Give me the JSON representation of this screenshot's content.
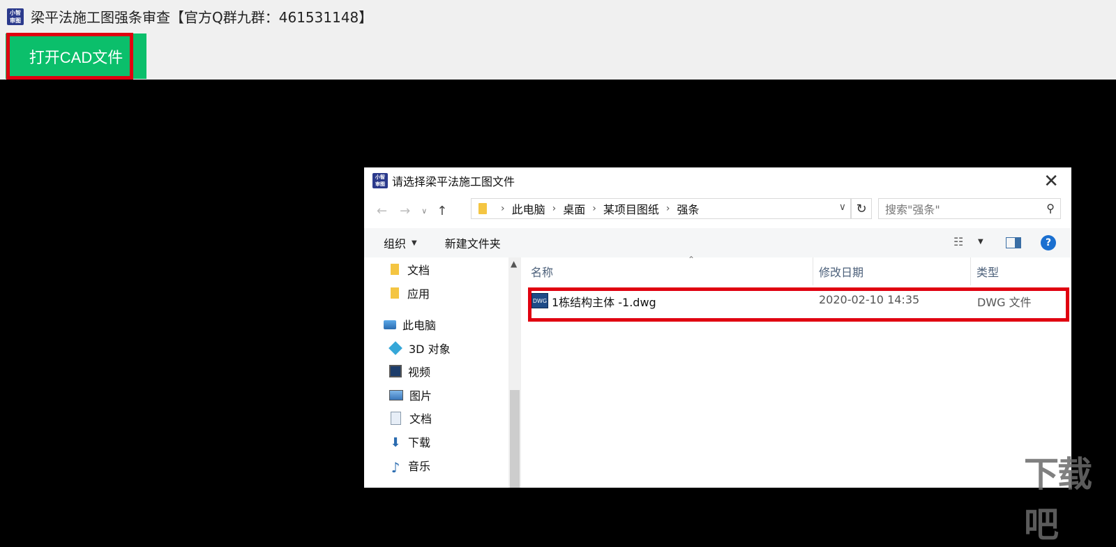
{
  "app": {
    "title": "梁平法施工图强条审查【官方Q群九群：461531148】",
    "logo_top": "小智",
    "logo_bottom": "审图"
  },
  "toolbar": {
    "open_cad_label": "打开CAD文件"
  },
  "dialog": {
    "title": "请选择梁平法施工图文件",
    "close_glyph": "✕",
    "nav": {
      "back": "←",
      "forward": "→",
      "dropdown": "∨",
      "up": "↑",
      "refresh": "↻"
    },
    "breadcrumb": [
      "此电脑",
      "桌面",
      "某项目图纸",
      "强条"
    ],
    "search_placeholder": "搜索\"强条\"",
    "commands": {
      "organize": "组织",
      "new_folder": "新建文件夹"
    },
    "nav_pane": [
      {
        "label": "文档",
        "icon": "folder-icon"
      },
      {
        "label": "应用",
        "icon": "folder-icon"
      },
      {
        "label": "此电脑",
        "icon": "computer-icon"
      },
      {
        "label": "3D 对象",
        "icon": "3d-objects-icon"
      },
      {
        "label": "视频",
        "icon": "video-icon"
      },
      {
        "label": "图片",
        "icon": "picture-icon"
      },
      {
        "label": "文档",
        "icon": "document-icon"
      },
      {
        "label": "下载",
        "icon": "download-icon"
      },
      {
        "label": "音乐",
        "icon": "music-icon"
      }
    ],
    "columns": {
      "name": "名称",
      "date": "修改日期",
      "type": "类型"
    },
    "files": [
      {
        "name": "1栋结构主体 -1.dwg",
        "date": "2020-02-10 14:35",
        "type": "DWG 文件",
        "icon": "dwg-file-icon"
      }
    ]
  },
  "watermark": {
    "text": "下载吧"
  },
  "colors": {
    "accent_green": "#0bbf6b",
    "highlight_red": "#e00010",
    "canvas_black": "#000000"
  }
}
